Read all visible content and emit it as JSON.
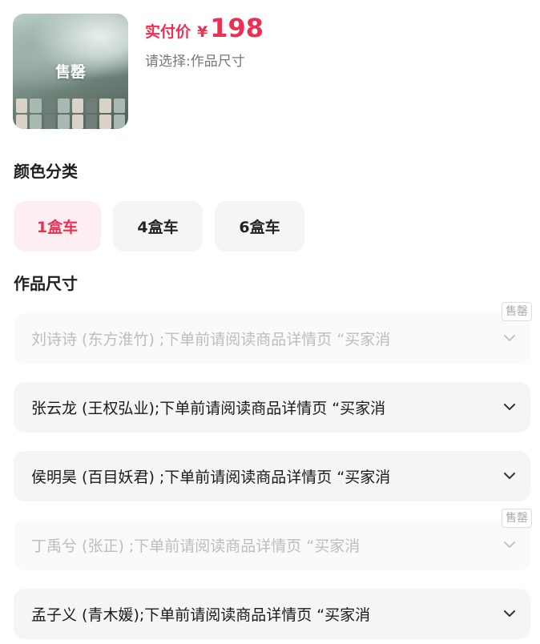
{
  "product": {
    "thumb_badge": "售罄",
    "price_label": "实付价",
    "currency": "¥",
    "price": "198",
    "select_hint": "请选择:作品尺寸"
  },
  "color_section": {
    "title": "颜色分类",
    "options": [
      {
        "label": "1盒车",
        "selected": true
      },
      {
        "label": "4盒车",
        "selected": false
      },
      {
        "label": "6盒车",
        "selected": false
      }
    ]
  },
  "size_section": {
    "title": "作品尺寸",
    "sold_out_tag": "售罄",
    "options": [
      {
        "label": "刘诗诗 (东方淮竹) ;下单前请阅读商品详情页 “买家消",
        "sold_out": true
      },
      {
        "label": "张云龙 (王权弘业);下单前请阅读商品详情页 “买家消",
        "sold_out": false
      },
      {
        "label": "侯明昊 (百目妖君) ;下单前请阅读商品详情页 “买家消",
        "sold_out": false
      },
      {
        "label": "丁禹兮 (张正) ;下单前请阅读商品详情页 “买家消",
        "sold_out": true
      },
      {
        "label": "孟子义 (青木媛);下单前请阅读商品详情页 “买家消",
        "sold_out": false
      }
    ]
  },
  "colors": {
    "accent": "#ec2f52",
    "chip_bg": "#f5f5f7",
    "selected_bg": "#fdeff1",
    "disabled_text": "#bdbdbd"
  },
  "icons": {
    "dropdown": "chevron-down-icon"
  }
}
